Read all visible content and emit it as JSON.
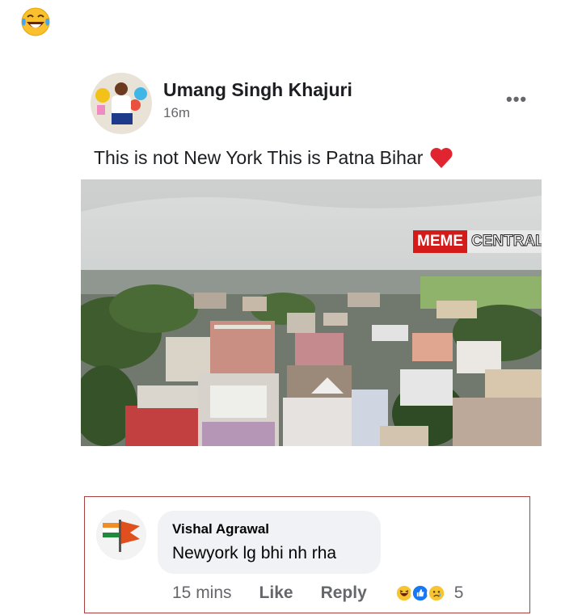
{
  "top_emoji": "laughing-crying-emoji",
  "post": {
    "author": "Umang Singh Khajuri",
    "time": "16m",
    "text": "This is not New York This is Patna Bihar",
    "text_emoji": "red-heart",
    "more_label": "•••",
    "watermark_part1": "MEME",
    "watermark_part2": "CENTRAL"
  },
  "comment": {
    "author": "Vishal Agrawal",
    "text": "Newyork lg bhi nh rha",
    "time": "15 mins",
    "like_label": "Like",
    "reply_label": "Reply",
    "reaction_icons": [
      "haha-reaction",
      "like-reaction",
      "sad-reaction"
    ],
    "reaction_count": "5"
  },
  "colors": {
    "facebook_blue": "#1877f2",
    "heart_red": "#e02430",
    "watermark_red": "#d51a1a"
  }
}
